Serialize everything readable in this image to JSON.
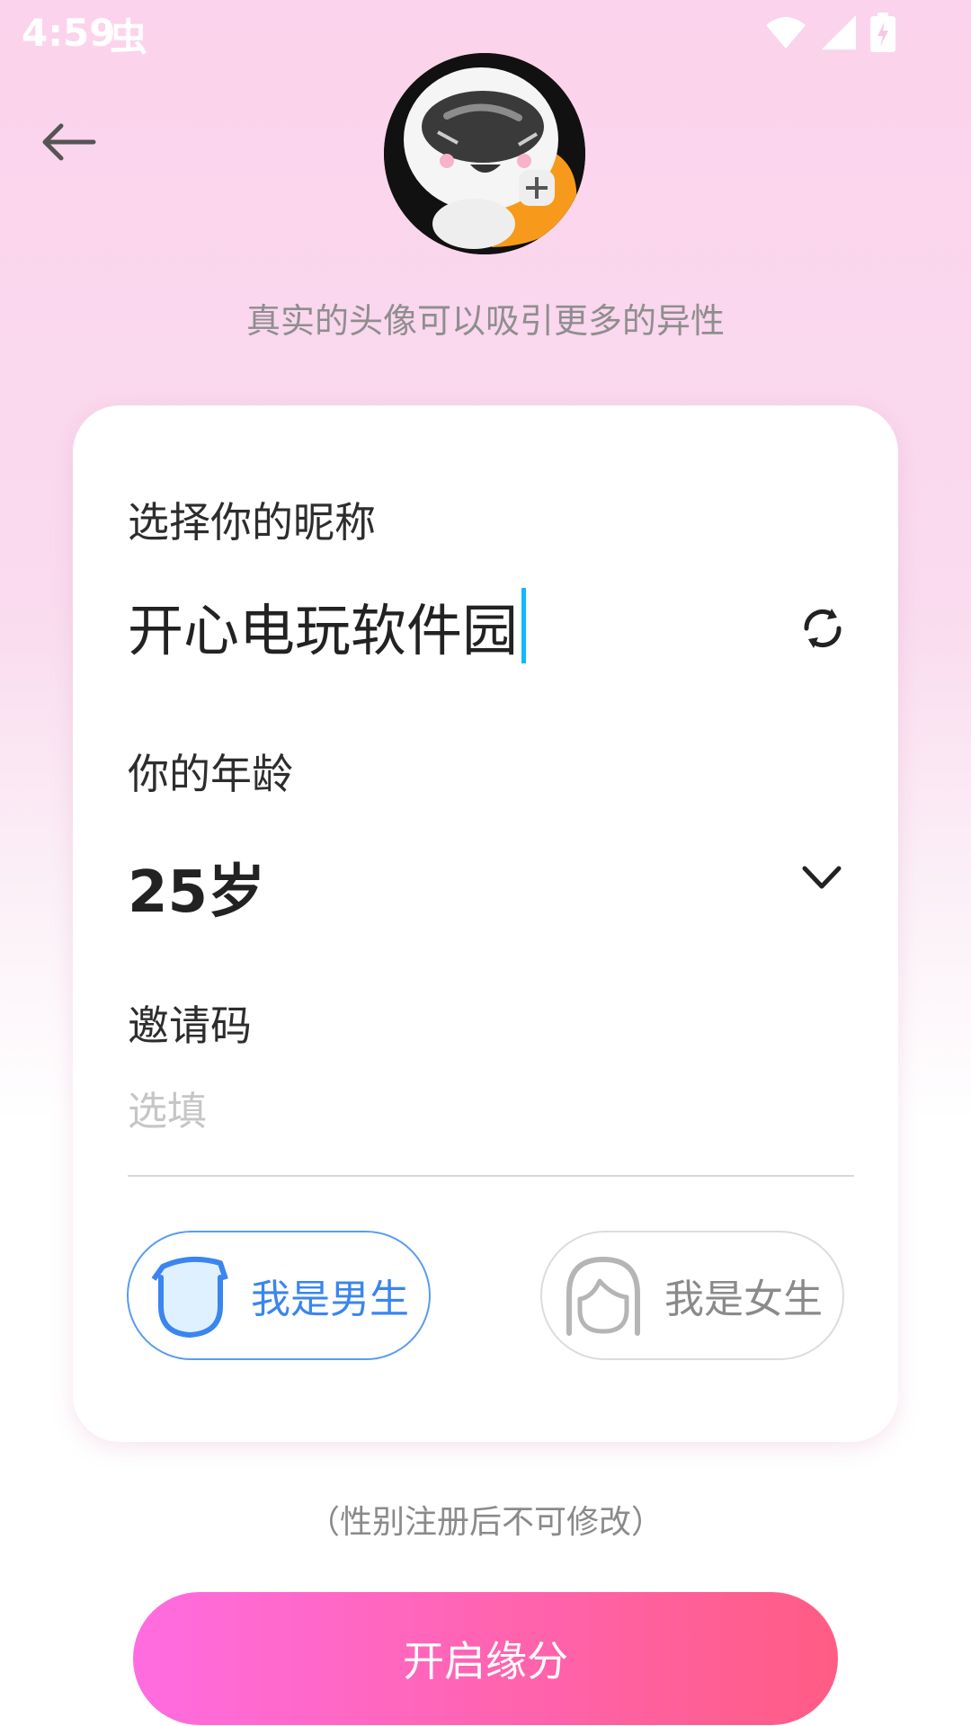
{
  "status_bar": {
    "time": "4:59",
    "notification_glyph": "虫",
    "icons": [
      "wifi-icon",
      "signal-icon",
      "battery-charging-icon"
    ]
  },
  "header": {
    "back_icon": "arrow-left-icon",
    "avatar_hint": "真实的头像可以吸引更多的异性"
  },
  "form": {
    "nickname_label": "选择你的昵称",
    "nickname_value": "开心电玩软件园",
    "refresh_icon": "refresh-icon",
    "age_label": "你的年龄",
    "age_value": "25岁",
    "age_dropdown_icon": "chevron-down-icon",
    "invite_label": "邀请码",
    "invite_placeholder": "选填",
    "invite_value": "",
    "gender": {
      "male_label": "我是男生",
      "female_label": "我是女生",
      "selected": "male"
    }
  },
  "gender_note": "（性别注册后不可修改）",
  "submit_label": "开启缘分",
  "colors": {
    "accent_blue": "#3a85f0",
    "cursor": "#13b7ff",
    "button_gradient_start": "#ff6ce0",
    "button_gradient_end": "#ff5c84"
  }
}
